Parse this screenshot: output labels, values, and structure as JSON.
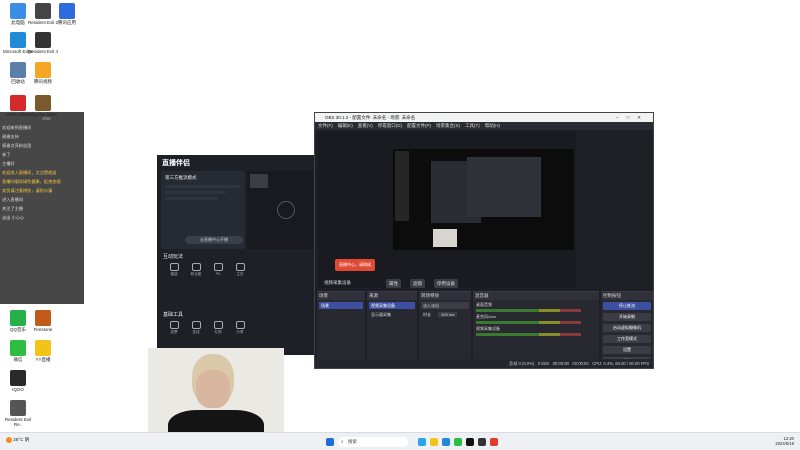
{
  "desktop": {
    "icons": [
      {
        "label": "此电脑",
        "color": "#3a8ee6"
      },
      {
        "label": "Resident Evil 2",
        "color": "#444"
      },
      {
        "label": "腾讯应用",
        "color": "#2d6cdf"
      },
      {
        "label": "Microsoft Edge",
        "color": "#1f8ad6"
      },
      {
        "label": "Resident Evil 4",
        "color": "#333"
      },
      {
        "label": "回收站",
        "color": "#5a7fa8"
      },
      {
        "label": "腾讯视频",
        "color": "#f5a623"
      },
      {
        "label": "WPS Office",
        "color": "#d42a2a"
      },
      {
        "label": "Slay the Spire",
        "color": "#7a5a2a"
      },
      {
        "label": "QQ音乐",
        "color": "#26b04a"
      },
      {
        "label": "Firestone",
        "color": "#c25a1a"
      },
      {
        "label": "微信",
        "color": "#2dbd43"
      },
      {
        "label": "YY直播",
        "color": "#f2c318"
      },
      {
        "label": "IQOO",
        "color": "#2a2a2a"
      },
      {
        "label": "Resident Evil Re..",
        "color": "#555"
      }
    ]
  },
  "chat": {
    "header": "ONE",
    "lines": [
      {
        "text": "欢迎来到直播间",
        "highlight": false
      },
      {
        "text": "谢谢支持",
        "highlight": false
      },
      {
        "text": "感谢点亮粉丝团",
        "highlight": false
      },
      {
        "text": "来了",
        "highlight": false
      },
      {
        "text": "主播好",
        "highlight": false
      },
      {
        "text": "欢迎进入直播间，点点赞就送",
        "highlight": true
      },
      {
        "text": "直播间倡导绿色健康，拒绝违规",
        "highlight": true
      },
      {
        "text": "卖货请注意辨别，谨防诈骗",
        "highlight": true
      },
      {
        "text": "进入直播间",
        "highlight": false
      },
      {
        "text": "关注了主播",
        "highlight": false
      },
      {
        "text": "送出 小心心",
        "highlight": false
      }
    ]
  },
  "zb_app": {
    "title": "直播伴侣",
    "mode_label": "第三方推流模式",
    "start_button": "去直播中心开播",
    "sec_interact": "互动玩法",
    "sec_tools": "基础工具",
    "tools": [
      "福袋",
      "粉丝团",
      "PK",
      "主页",
      "投票",
      "连线",
      "礼物",
      "分享"
    ],
    "zoom": "100%"
  },
  "obs": {
    "title": "OBS 30.1.2 - 配置文件: 未命名 - 场景: 未命名",
    "menu": [
      "文件(F)",
      "编辑(E)",
      "查看(V)",
      "停靠窗口(D)",
      "配置文件(P)",
      "场景集合(S)",
      "工具(T)",
      "帮助(H)"
    ],
    "toolbar": {
      "source_label": "视频采集设备",
      "props": "属性",
      "filters": "滤镜",
      "activate": "停用设备"
    },
    "docks": {
      "scenes": {
        "title": "场景",
        "items": [
          "场景"
        ]
      },
      "sources": {
        "title": "来源",
        "items": [
          "视频采集设备",
          "显示器采集"
        ]
      },
      "transitions": {
        "title": "转场特效",
        "type": "淡入淡出",
        "duration_label": "时长",
        "duration": "300 ms"
      },
      "mixer": {
        "title": "混音器",
        "channels": [
          "桌面音频",
          "麦克风/Aux",
          "视频采集设备"
        ]
      },
      "controls": {
        "title": "控制按钮",
        "buttons": [
          "停止推流",
          "开始录制",
          "启动虚拟摄像机",
          "工作室模式",
          "设置",
          "退出"
        ]
      }
    },
    "status": {
      "dropped": "丢帧 0 (0.0%)",
      "bitrate": "0 kb/s",
      "live_time": "00:00:00",
      "rec_time": "00:00:00",
      "cpu": "CPU: 0.4%, 60.00 / 60.00 FPS"
    }
  },
  "overlay": {
    "red_label": "直播中心，请稍候"
  },
  "taskbar": {
    "weather": "26°C 阴",
    "search": "搜索",
    "time": "12:20",
    "date": "2024/6/19",
    "icons": [
      {
        "name": "windows",
        "color": "#1f6fd6"
      },
      {
        "name": "widgets",
        "color": "#2aa5e8"
      },
      {
        "name": "explorer",
        "color": "#f2c318"
      },
      {
        "name": "edge",
        "color": "#1f8ad6"
      },
      {
        "name": "wechat",
        "color": "#2dbd43"
      },
      {
        "name": "tiktok",
        "color": "#111"
      },
      {
        "name": "obs",
        "color": "#333"
      },
      {
        "name": "chrome",
        "color": "#e33b2e"
      }
    ]
  }
}
